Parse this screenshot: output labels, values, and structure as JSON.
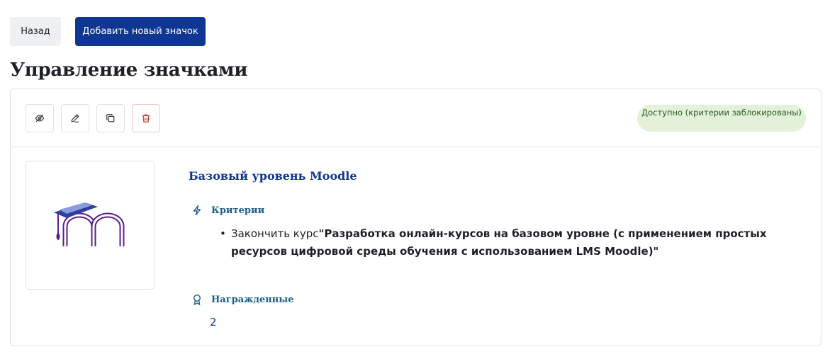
{
  "toolbar": {
    "back_label": "Назад",
    "add_label": "Добавить новый значок"
  },
  "page_title": "Управление значками",
  "card": {
    "actions": {
      "visibility_icon": "eye-slash-icon",
      "edit_icon": "pencil-icon",
      "copy_icon": "copy-icon",
      "delete_icon": "trash-icon"
    },
    "status": "Доступно (критерии заблокированы)",
    "badge_name": "Базовый уровень Moodle",
    "criteria": {
      "heading": "Критерии",
      "icon": "bolt-icon",
      "item_prefix": "Закончить курс",
      "item_course": "\"Разработка онлайн-курсов на базовом уровне (с применением простых ресурсов цифровой среды обучения с использованием LMS Moodle)\""
    },
    "recipients": {
      "heading": "Награжденные",
      "icon": "award-icon",
      "count": "2"
    }
  },
  "colors": {
    "primary": "#0f3693",
    "status_bg": "#e3f1d9",
    "danger": "#c0392b",
    "logo_purple": "#5a1f8a",
    "logo_cap": "#2d3f9e"
  }
}
